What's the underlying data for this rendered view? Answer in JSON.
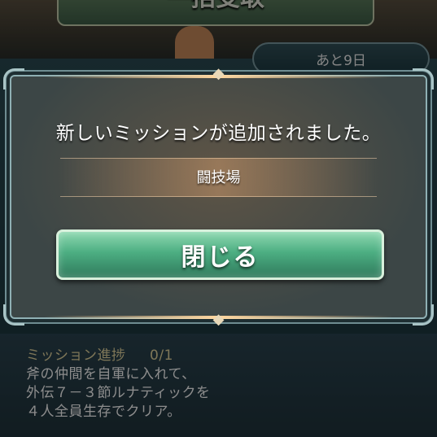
{
  "background": {
    "top_button_label": "一括受取",
    "days_left_badge": "あと9日",
    "mission": {
      "progress_label": "ミッション進捗",
      "progress_value": "0/1",
      "lines": [
        "斧の仲間を自軍に入れて、",
        "外伝７－３節ルナティックを",
        "４人全員生存でクリア。"
      ]
    }
  },
  "dialog": {
    "message": "新しいミッションが追加されました。",
    "mission_name": "闘技場",
    "close_label": "閉じる"
  },
  "colors": {
    "dialog_border": "#8fb0b4",
    "button_green": "#4cae82",
    "glow": "#ffd7a0"
  }
}
